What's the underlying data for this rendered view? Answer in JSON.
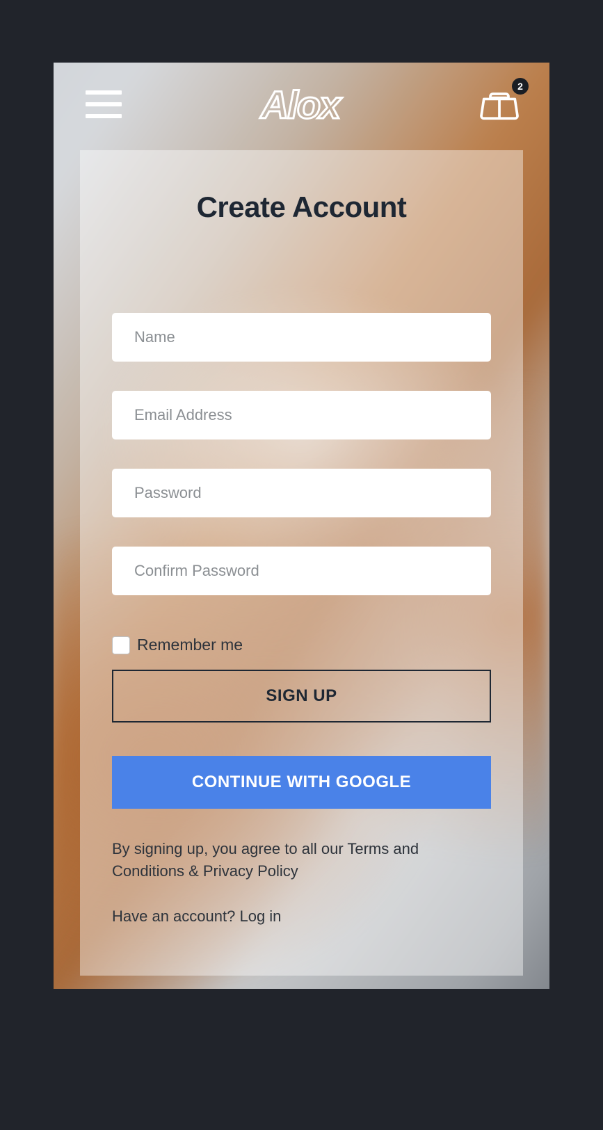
{
  "header": {
    "logo_text": "Alox",
    "cart_badge": "2"
  },
  "card": {
    "title": "Create Account",
    "fields": {
      "name_placeholder": "Name",
      "email_placeholder": "Email Address",
      "password_placeholder": "Password",
      "confirm_placeholder": "Confirm Password"
    },
    "remember_label": "Remember me",
    "signup_button": "SIGN UP",
    "google_button": "CONTINUE WITH GOOGLE",
    "legal_text": "By signing up, you agree to all our Terms and Conditions & Privacy Policy",
    "have_account_prefix": "Have an account? ",
    "login_link": "Log in"
  },
  "colors": {
    "accent_blue": "#4a82e8",
    "dark_text": "#1e2733",
    "page_bg": "#21242b"
  }
}
